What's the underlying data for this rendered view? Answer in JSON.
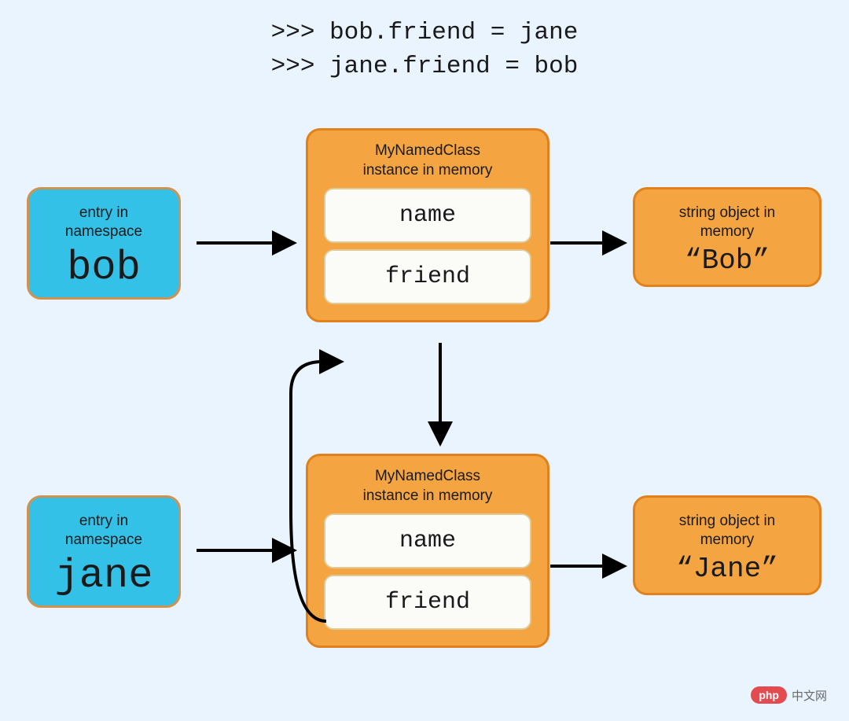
{
  "code": {
    "line1": ">>> bob.friend = jane",
    "line2": ">>> jane.friend = bob"
  },
  "namespace": {
    "label": "entry in\nnamespace",
    "bob": "bob",
    "jane": "jane"
  },
  "instance": {
    "label": "MyNamedClass\ninstance in memory",
    "attr1": "name",
    "attr2": "friend"
  },
  "stringObj": {
    "label": "string object in\nmemory",
    "bob": "“Bob”",
    "jane": "“Jane”"
  },
  "watermark": {
    "logo": "php",
    "text": "中文网"
  },
  "chart_data": {
    "type": "diagram",
    "title": "Python object references - circular friend relationship",
    "code_statements": [
      "bob.friend = jane",
      "jane.friend = bob"
    ],
    "nodes": [
      {
        "id": "ns_bob",
        "type": "namespace_entry",
        "label": "bob"
      },
      {
        "id": "ns_jane",
        "type": "namespace_entry",
        "label": "jane"
      },
      {
        "id": "inst_bob",
        "type": "MyNamedClass_instance",
        "attributes": [
          "name",
          "friend"
        ]
      },
      {
        "id": "inst_jane",
        "type": "MyNamedClass_instance",
        "attributes": [
          "name",
          "friend"
        ]
      },
      {
        "id": "str_bob",
        "type": "string_object",
        "value": "Bob"
      },
      {
        "id": "str_jane",
        "type": "string_object",
        "value": "Jane"
      }
    ],
    "edges": [
      {
        "from": "ns_bob",
        "to": "inst_bob"
      },
      {
        "from": "ns_jane",
        "to": "inst_jane"
      },
      {
        "from": "inst_bob",
        "attr": "name",
        "to": "str_bob"
      },
      {
        "from": "inst_jane",
        "attr": "name",
        "to": "str_jane"
      },
      {
        "from": "inst_bob",
        "attr": "friend",
        "to": "inst_jane"
      },
      {
        "from": "inst_jane",
        "attr": "friend",
        "to": "inst_bob"
      }
    ]
  }
}
